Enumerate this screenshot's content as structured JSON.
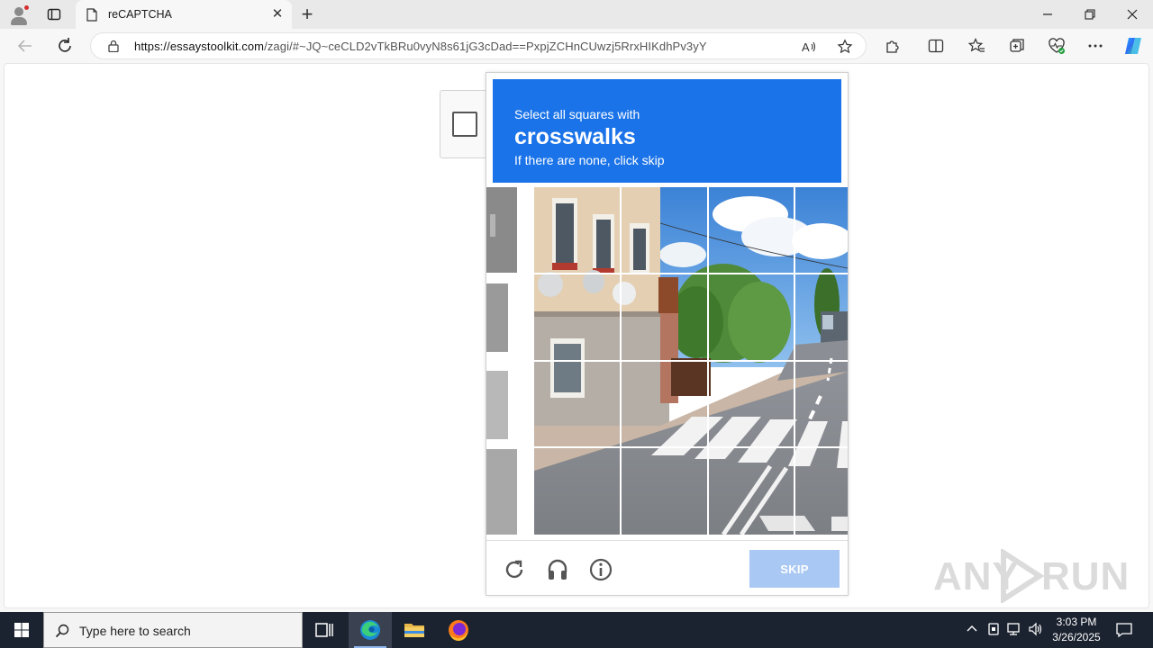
{
  "browser": {
    "tab_title": "reCAPTCHA",
    "url_domain": "https://essaystoolkit.com",
    "url_path": "/zagi/#~JQ~ceCLD2vTkBRu0vyN8s61jG3cDad==PxpjZCHnCUwzj5RrxHIKdhPv3yY",
    "close_tab_glyph": "✕",
    "new_tab_glyph": "+",
    "window_controls": [
      "minimize",
      "restore",
      "close"
    ]
  },
  "captcha": {
    "instruction_line1": "Select all squares with",
    "target_object": "crosswalks",
    "instruction_line3": "If there are none, click skip",
    "grid_rows": 4,
    "grid_cols": 4,
    "skip_label": "SKIP",
    "footer_icons": [
      "reload-icon",
      "headphones-icon",
      "info-icon"
    ]
  },
  "watermark_text": "ANY RUN",
  "taskbar": {
    "search_placeholder": "Type here to search",
    "time": "3:03 PM",
    "date": "3/26/2025",
    "apps": [
      "task-view-icon",
      "edge-icon",
      "file-explorer-icon",
      "firefox-icon"
    ]
  },
  "colors": {
    "banner_blue": "#1a73e8",
    "skip_disabled": "#a9c8f4",
    "taskbar": "#1c2330"
  }
}
